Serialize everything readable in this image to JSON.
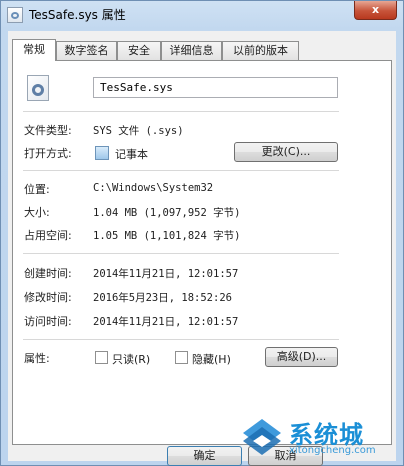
{
  "window": {
    "title": "TesSafe.sys 属性",
    "close_label": "x"
  },
  "tabs": [
    {
      "label": "常规",
      "active": true
    },
    {
      "label": "数字签名",
      "active": false
    },
    {
      "label": "安全",
      "active": false
    },
    {
      "label": "详细信息",
      "active": false
    },
    {
      "label": "以前的版本",
      "active": false
    }
  ],
  "general": {
    "filename": "TesSafe.sys",
    "file_type_label": "文件类型:",
    "file_type_value": "SYS 文件 (.sys)",
    "open_with_label": "打开方式:",
    "open_with_value": "记事本",
    "change_button": "更改(C)...",
    "location_label": "位置:",
    "location_value": "C:\\Windows\\System32",
    "size_label": "大小:",
    "size_value": "1.04 MB (1,097,952 字节)",
    "size_on_disk_label": "占用空间:",
    "size_on_disk_value": "1.05 MB (1,101,824 字节)",
    "created_label": "创建时间:",
    "created_value": "2014年11月21日, 12:01:57",
    "modified_label": "修改时间:",
    "modified_value": "2016年5月23日, 18:52:26",
    "accessed_label": "访问时间:",
    "accessed_value": "2014年11月21日, 12:01:57",
    "attributes_label": "属性:",
    "readonly_label": "只读(R)",
    "hidden_label": "隐藏(H)",
    "advanced_button": "高级(D)..."
  },
  "footer": {
    "ok_button": "确定",
    "cancel_button": "取消"
  },
  "watermark": {
    "brand": "系统城",
    "url": "xitongcheng.com"
  }
}
